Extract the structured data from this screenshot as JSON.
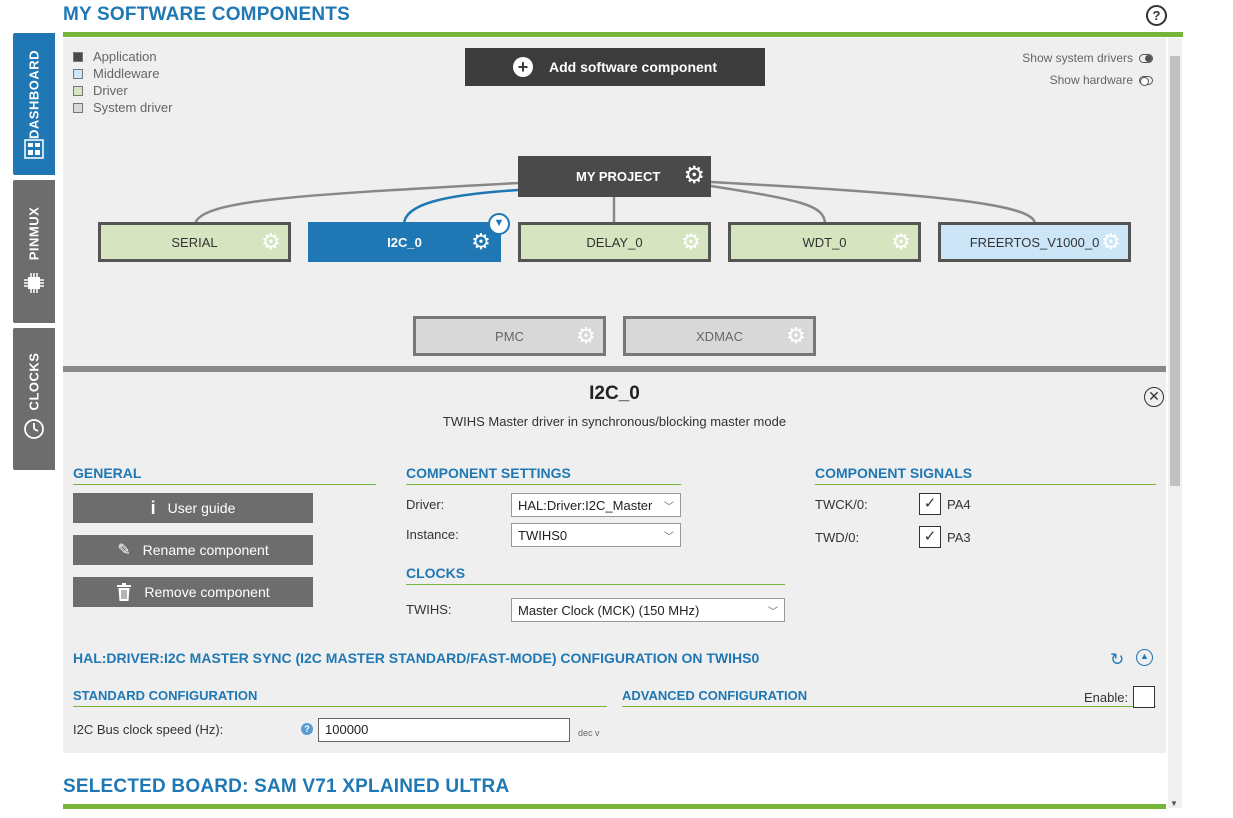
{
  "header": {
    "title": "MY SOFTWARE COMPONENTS",
    "help_icon": "?"
  },
  "side_tabs": [
    {
      "label": "DASHBOARD",
      "icon": "dashboard-icon",
      "active": true
    },
    {
      "label": "PINMUX",
      "icon": "chip-icon",
      "active": false
    },
    {
      "label": "CLOCKS",
      "icon": "clock-icon",
      "active": false
    }
  ],
  "legend": [
    {
      "label": "Application",
      "color": "#4a4a4a"
    },
    {
      "label": "Middleware",
      "color": "#cce6f7"
    },
    {
      "label": "Driver",
      "color": "#d6e4c0"
    },
    {
      "label": "System driver",
      "color": "#d8d8d8"
    }
  ],
  "add_button": {
    "label": "Add software component"
  },
  "toggles": {
    "system_drivers": {
      "label": "Show system drivers",
      "on": true
    },
    "hardware": {
      "label": "Show hardware",
      "on": false
    }
  },
  "project": {
    "label": "MY PROJECT"
  },
  "components": [
    {
      "label": "SERIAL",
      "kind": "driver"
    },
    {
      "label": "I2C_0",
      "kind": "selected"
    },
    {
      "label": "DELAY_0",
      "kind": "driver"
    },
    {
      "label": "WDT_0",
      "kind": "driver"
    },
    {
      "label": "FREERTOS_V1000_0",
      "kind": "middleware"
    }
  ],
  "system_components": [
    {
      "label": "PMC"
    },
    {
      "label": "XDMAC"
    }
  ],
  "detail": {
    "title": "I2C_0",
    "description": "TWIHS Master driver in synchronous/blocking master mode",
    "general": {
      "heading": "GENERAL",
      "user_guide": "User guide",
      "rename": "Rename component",
      "remove": "Remove component"
    },
    "settings": {
      "heading": "COMPONENT SETTINGS",
      "driver_label": "Driver:",
      "driver_value": "HAL:Driver:I2C_Master",
      "instance_label": "Instance:",
      "instance_value": "TWIHS0"
    },
    "clocks": {
      "heading": "CLOCKS",
      "twihs_label": "TWIHS:",
      "twihs_value": "Master Clock (MCK) (150 MHz)"
    },
    "signals": {
      "heading": "COMPONENT SIGNALS",
      "items": [
        {
          "label": "TWCK/0:",
          "pin": "PA4",
          "checked": true
        },
        {
          "label": "TWD/0:",
          "pin": "PA3",
          "checked": true
        }
      ]
    },
    "config": {
      "heading": "HAL:DRIVER:I2C MASTER SYNC (I2C MASTER STANDARD/FAST-MODE) CONFIGURATION ON TWIHS0",
      "standard_heading": "STANDARD CONFIGURATION",
      "advanced_heading": "ADVANCED CONFIGURATION",
      "enable_label": "Enable:",
      "bus_clock_label": "I2C Bus clock speed (Hz):",
      "bus_clock_value": "100000",
      "format_label": "dec v"
    }
  },
  "board": {
    "title": "SELECTED BOARD: SAM V71 XPLAINED ULTRA"
  }
}
